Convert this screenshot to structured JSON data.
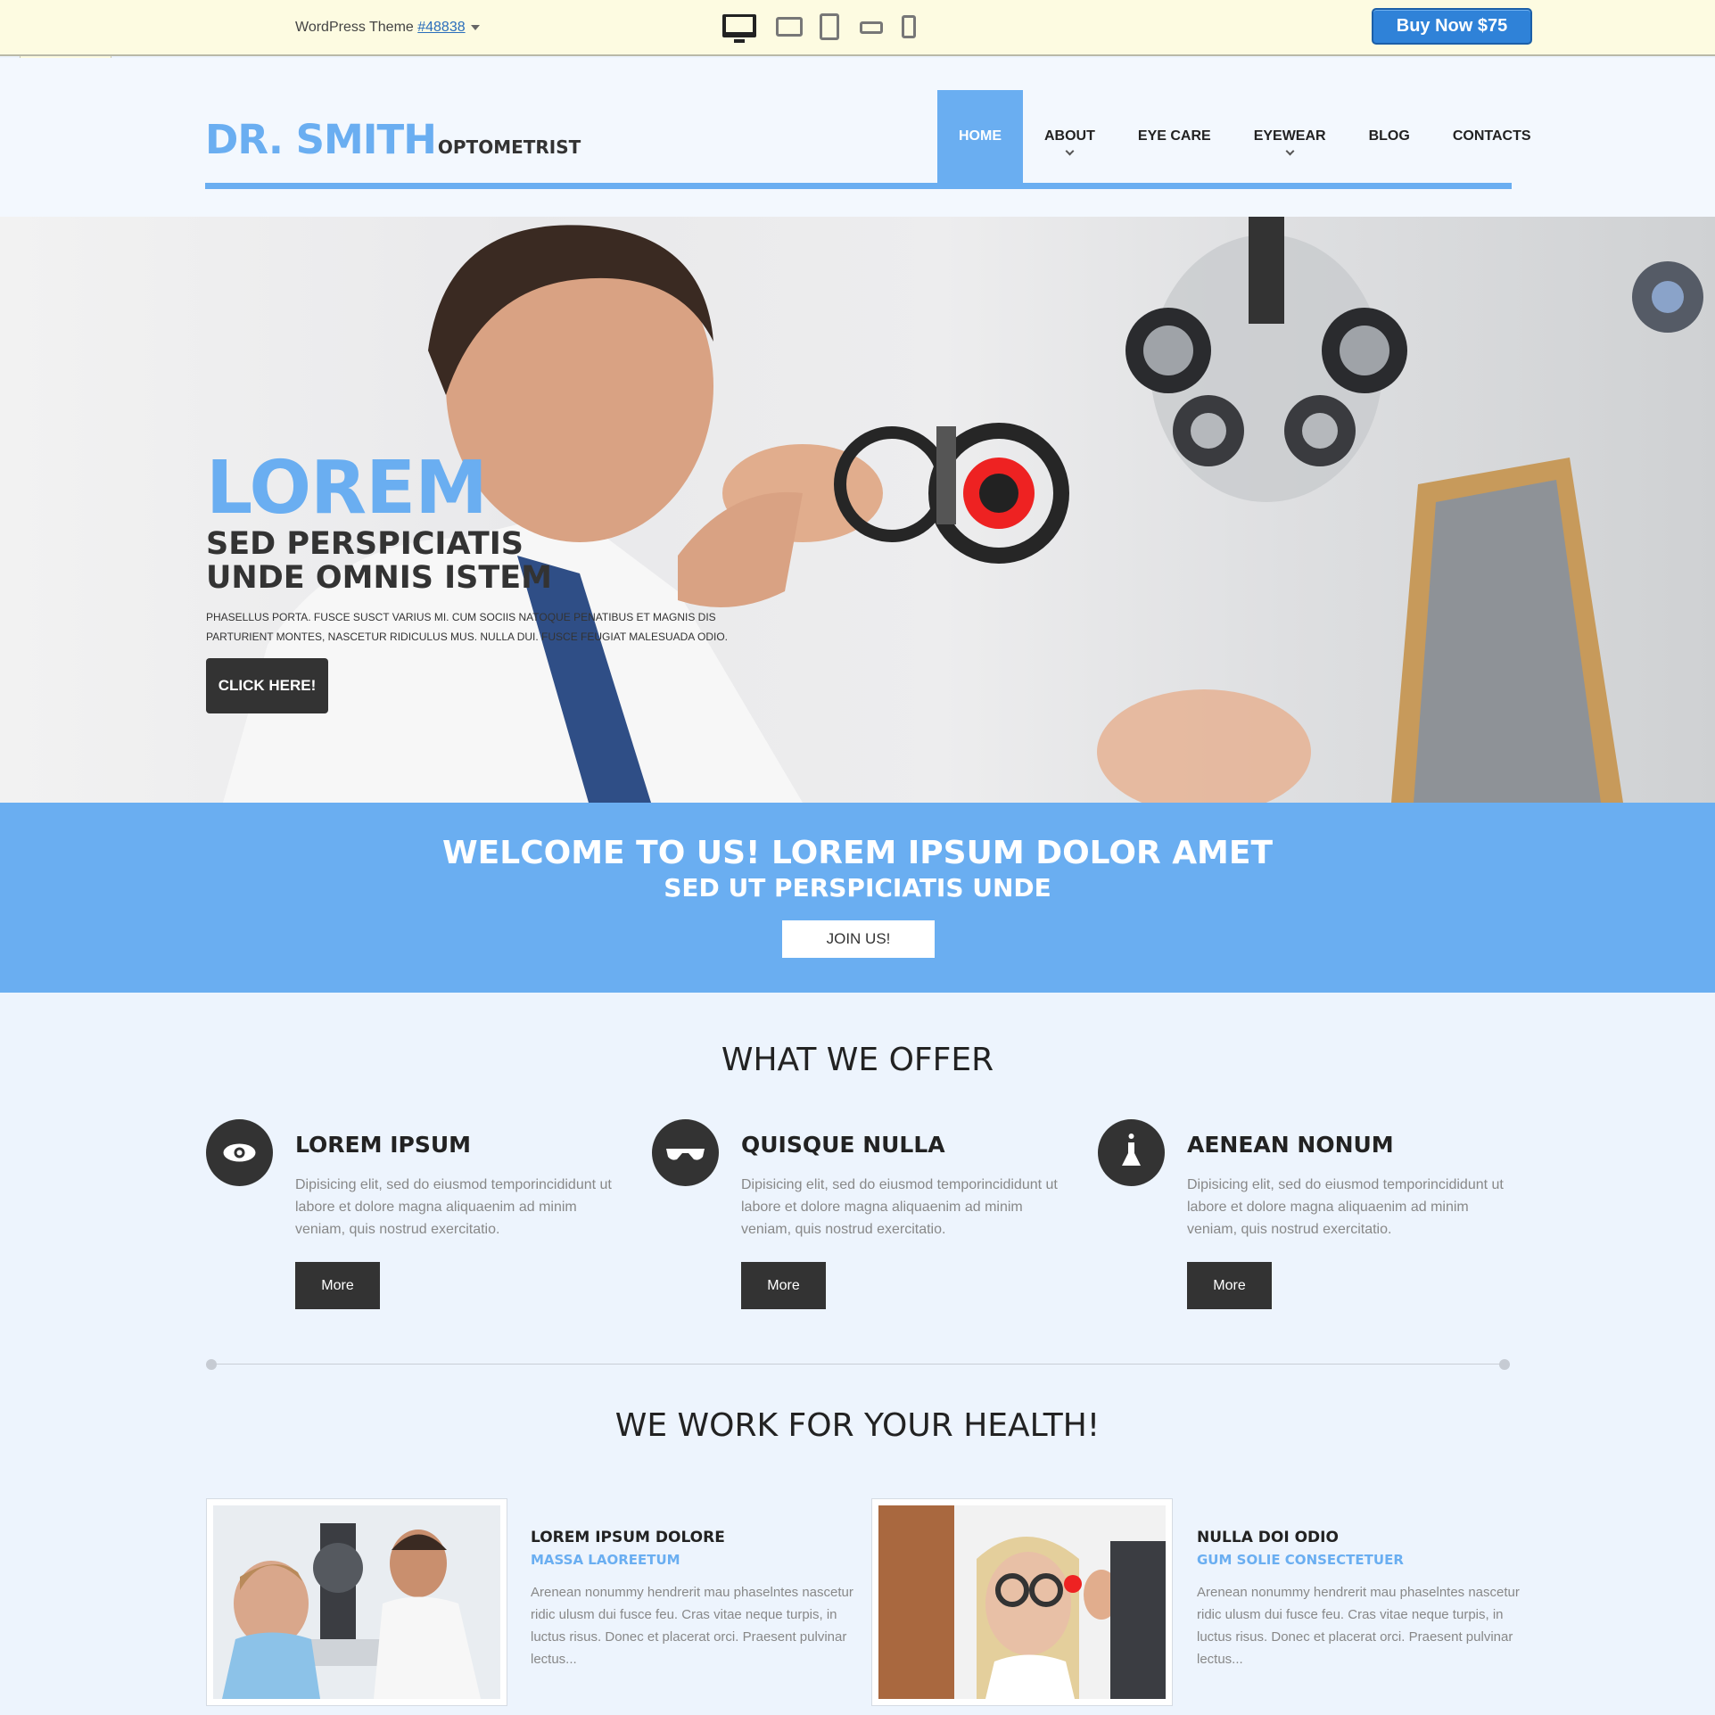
{
  "preview_bar": {
    "theme_prefix": "WordPress Theme ",
    "theme_number": "#48838",
    "buy_label": "Buy Now $75"
  },
  "header": {
    "logo_main": "DR. SMITH",
    "logo_sub": "OPTOMETRIST",
    "nav": [
      {
        "label": "HOME"
      },
      {
        "label": "ABOUT"
      },
      {
        "label": "EYE CARE"
      },
      {
        "label": "EYEWEAR"
      },
      {
        "label": "BLOG"
      },
      {
        "label": "CONTACTS"
      }
    ]
  },
  "hero": {
    "title": "LOREM",
    "sub1": "SED PERSPICIATIS",
    "sub2": "UNDE OMNIS ISTEM",
    "text": "PHASELLUS PORTA. FUSCE SUSCT VARIUS MI. CUM SOCIIS NATOQUE PENATIBUS ET MAGNIS DIS PARTURIENT MONTES, NASCETUR RIDICULUS MUS. NULLA DUI. FUSCE FEUGIAT MALESUADA ODIO.",
    "button": "CLICK HERE!"
  },
  "welcome": {
    "title": "WELCOME TO US! LOREM IPSUM DOLOR AMET",
    "subtitle": "SED UT PERSPICIATIS UNDE",
    "button": "JOIN US!"
  },
  "offer": {
    "title": "WHAT WE OFFER",
    "items": [
      {
        "icon": "eye-icon",
        "title": "LOREM IPSUM",
        "text": "Dipisicing elit, sed do eiusmod temporincididunt ut labore et dolore magna aliquaenim ad minim veniam, quis nostrud exercitatio.",
        "button": "More"
      },
      {
        "icon": "sunglasses-icon",
        "title": "QUISQUE NULLA",
        "text": "Dipisicing elit, sed do eiusmod temporincididunt ut labore et dolore magna aliquaenim ad minim veniam, quis nostrud exercitatio.",
        "button": "More"
      },
      {
        "icon": "flask-icon",
        "title": "AENEAN NONUM",
        "text": "Dipisicing elit, sed do eiusmod temporincididunt ut labore et dolore magna aliquaenim ad minim veniam, quis nostrud exercitatio.",
        "button": "More"
      }
    ]
  },
  "health": {
    "title": "WE WORK FOR YOUR HEALTH!",
    "items": [
      {
        "title": "LOREM IPSUM DOLORE",
        "subtitle": "MASSA LAOREETUM",
        "text": "Arenean nonummy hendrerit mau phaselntes nascetur ridic ulusm dui fusce feu. Cras vitae neque turpis, in luctus risus. Donec et placerat orci. Praesent pulvinar lectus..."
      },
      {
        "title": "NULLA DOI ODIO",
        "subtitle": "GUM SOLIE CONSECTETUER",
        "text": "Arenean nonummy hendrerit mau phaselntes nascetur ridic ulusm dui fusce feu. Cras vitae neque turpis, in luctus risus. Donec et placerat orci. Praesent pulvinar lectus..."
      }
    ]
  },
  "colors": {
    "accent": "#6aaef1",
    "dark": "#333333",
    "buy_button": "#2f82d8",
    "preview_bar": "#fdfbe1"
  }
}
